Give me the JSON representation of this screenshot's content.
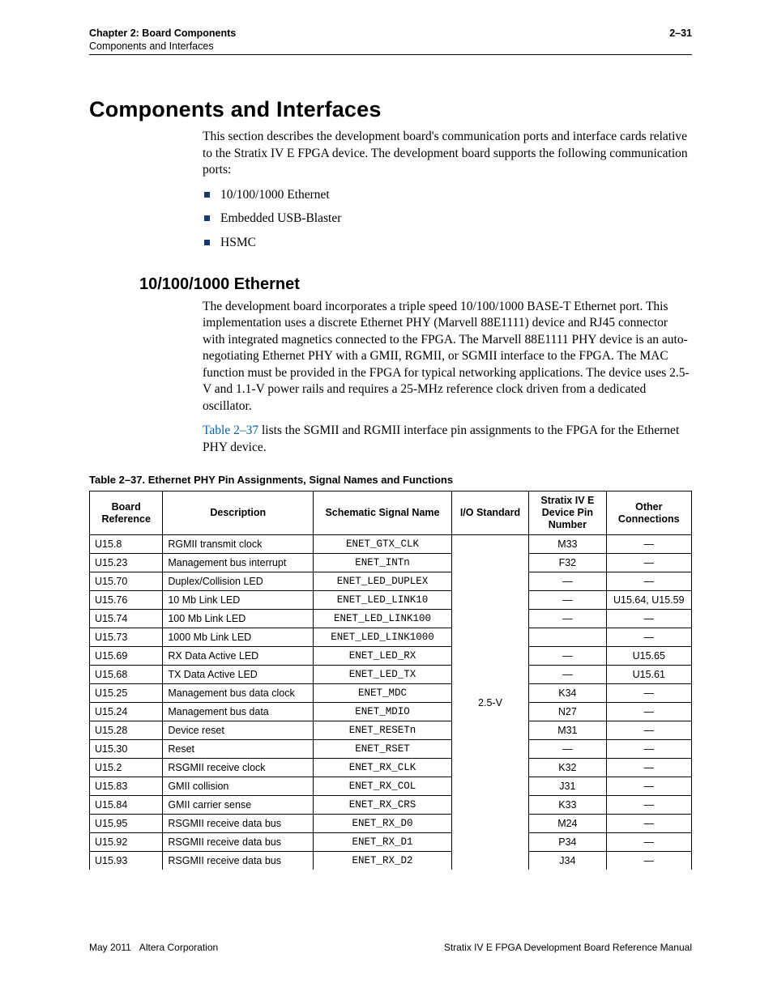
{
  "header": {
    "chapter": "Chapter 2: Board Components",
    "sub": "Components and Interfaces",
    "page": "2–31"
  },
  "h1": "Components and Interfaces",
  "intro": "This section describes the development board's communication ports and interface cards relative to the Stratix IV E FPGA device. The development board supports the following communication ports:",
  "bullets": [
    "10/100/1000 Ethernet",
    "Embedded USB-Blaster",
    "HSMC"
  ],
  "h2": "10/100/1000 Ethernet",
  "eth_p1": "The development board incorporates a triple speed 10/100/1000 BASE-T Ethernet port. This implementation uses a discrete Ethernet PHY (Marvell 88E1111) device and RJ45 connector with integrated magnetics connected to the FPGA. The Marvell 88E1111 PHY device is an auto-negotiating Ethernet PHY with a GMII, RGMII, or SGMII interface to the FPGA. The MAC function must be provided in the FPGA for typical networking applications. The device uses 2.5-V and 1.1-V power rails and requires a 25-MHz reference clock driven from a dedicated oscillator.",
  "xref": "Table 2–37",
  "eth_p2_rest": " lists the SGMII and RGMII interface pin assignments to the FPGA for the Ethernet PHY device.",
  "table_caption": "Table 2–37. Ethernet PHY Pin Assignments, Signal Names and Functions",
  "columns": [
    "Board Reference",
    "Description",
    "Schematic Signal Name",
    "I/O Standard",
    "Stratix IV E Device Pin Number",
    "Other Connections"
  ],
  "io_standard": "2.5-V",
  "rows": [
    {
      "ref": "U15.8",
      "desc": "RGMII transmit clock",
      "sig": "ENET_GTX_CLK",
      "pin": "M33",
      "other": "—"
    },
    {
      "ref": "U15.23",
      "desc": "Management bus interrupt",
      "sig": "ENET_INTn",
      "pin": "F32",
      "other": "—"
    },
    {
      "ref": "U15.70",
      "desc": "Duplex/Collision LED",
      "sig": "ENET_LED_DUPLEX",
      "pin": "—",
      "other": "—"
    },
    {
      "ref": "U15.76",
      "desc": "10 Mb Link LED",
      "sig": "ENET_LED_LINK10",
      "pin": "—",
      "other": "U15.64, U15.59"
    },
    {
      "ref": "U15.74",
      "desc": "100 Mb Link LED",
      "sig": "ENET_LED_LINK100",
      "pin": "—",
      "other": "—"
    },
    {
      "ref": "U15.73",
      "desc": "1000 Mb Link LED",
      "sig": "ENET_LED_LINK1000",
      "pin": "",
      "other": "—"
    },
    {
      "ref": "U15.69",
      "desc": "RX Data Active LED",
      "sig": "ENET_LED_RX",
      "pin": "—",
      "other": "U15.65"
    },
    {
      "ref": "U15.68",
      "desc": "TX Data Active LED",
      "sig": "ENET_LED_TX",
      "pin": "—",
      "other": "U15.61"
    },
    {
      "ref": "U15.25",
      "desc": "Management bus data clock",
      "sig": "ENET_MDC",
      "pin": "K34",
      "other": "—"
    },
    {
      "ref": "U15.24",
      "desc": "Management bus data",
      "sig": "ENET_MDIO",
      "pin": "N27",
      "other": "—"
    },
    {
      "ref": "U15.28",
      "desc": "Device reset",
      "sig": "ENET_RESETn",
      "pin": "M31",
      "other": "—"
    },
    {
      "ref": "U15.30",
      "desc": "Reset",
      "sig": "ENET_RSET",
      "pin": "—",
      "other": "—"
    },
    {
      "ref": "U15.2",
      "desc": "RSGMII receive clock",
      "sig": "ENET_RX_CLK",
      "pin": "K32",
      "other": "—"
    },
    {
      "ref": "U15.83",
      "desc": "GMII collision",
      "sig": "ENET_RX_COL",
      "pin": "J31",
      "other": "—"
    },
    {
      "ref": "U15.84",
      "desc": "GMII carrier sense",
      "sig": "ENET_RX_CRS",
      "pin": "K33",
      "other": "—"
    },
    {
      "ref": "U15.95",
      "desc": "RSGMII receive data bus",
      "sig": "ENET_RX_D0",
      "pin": "M24",
      "other": "—"
    },
    {
      "ref": "U15.92",
      "desc": "RSGMII receive data bus",
      "sig": "ENET_RX_D1",
      "pin": "P34",
      "other": "—"
    },
    {
      "ref": "U15.93",
      "desc": "RSGMII receive data bus",
      "sig": "ENET_RX_D2",
      "pin": "J34",
      "other": "—"
    }
  ],
  "footer": {
    "left": "May 2011   Altera Corporation",
    "right": "Stratix IV E FPGA Development Board Reference Manual"
  }
}
